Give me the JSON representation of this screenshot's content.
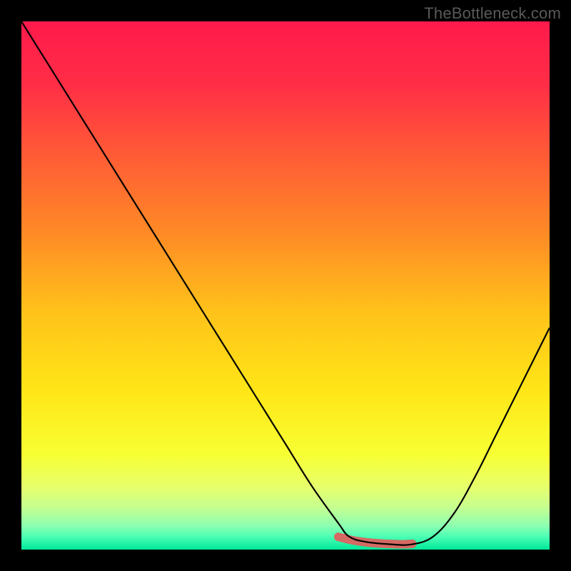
{
  "watermark": "TheBottleneck.com",
  "gradient": {
    "stops": [
      {
        "offset": 0.0,
        "color": "#ff1a4b"
      },
      {
        "offset": 0.12,
        "color": "#ff2e46"
      },
      {
        "offset": 0.25,
        "color": "#ff5a36"
      },
      {
        "offset": 0.4,
        "color": "#ff8a26"
      },
      {
        "offset": 0.55,
        "color": "#ffc21a"
      },
      {
        "offset": 0.7,
        "color": "#ffe617"
      },
      {
        "offset": 0.82,
        "color": "#f7ff33"
      },
      {
        "offset": 0.88,
        "color": "#e8ff6a"
      },
      {
        "offset": 0.92,
        "color": "#c6ff90"
      },
      {
        "offset": 0.955,
        "color": "#8cffb0"
      },
      {
        "offset": 0.975,
        "color": "#4dffb4"
      },
      {
        "offset": 1.0,
        "color": "#00e89a"
      }
    ]
  },
  "chart_data": {
    "type": "line",
    "title": "",
    "xlabel": "",
    "ylabel": "",
    "xlim": [
      0,
      100
    ],
    "ylim": [
      0,
      100
    ],
    "series": [
      {
        "name": "bottleneck-curve",
        "x": [
          0,
          5,
          10,
          15,
          20,
          25,
          30,
          35,
          40,
          45,
          50,
          55,
          60,
          62,
          65,
          70,
          74,
          78,
          82,
          86,
          90,
          94,
          98,
          100
        ],
        "values": [
          100,
          92,
          84,
          76,
          68,
          60,
          52,
          44,
          36,
          28,
          20,
          12,
          5,
          2.5,
          1.5,
          1.0,
          1.0,
          2.5,
          7,
          14,
          22,
          30,
          38,
          42
        ]
      }
    ],
    "marker": {
      "name": "highlight-segment",
      "color": "#d46a63",
      "stroke_width": 12,
      "x": [
        60,
        63,
        66,
        69,
        72,
        74
      ],
      "values": [
        2.4,
        1.7,
        1.3,
        1.1,
        1.0,
        1.1
      ]
    }
  }
}
